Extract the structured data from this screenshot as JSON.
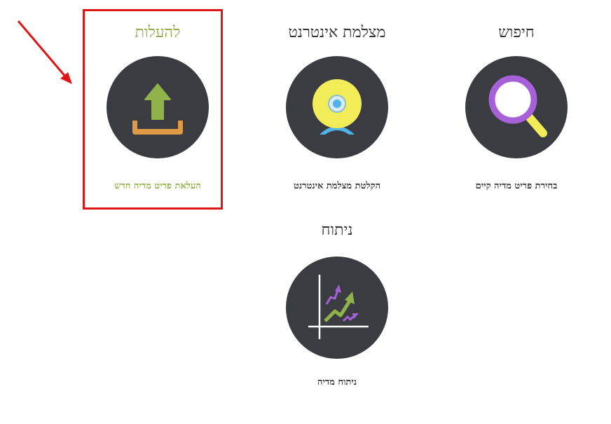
{
  "tiles": {
    "upload": {
      "title": "להעלות",
      "description": "העלאת פריט מדיה חדש",
      "icon": "upload-icon"
    },
    "webcam": {
      "title": "מצלמת אינטרנט",
      "description": "הקלטת מצלמת אינטרנט",
      "icon": "webcam-icon"
    },
    "search": {
      "title": "חיפוש",
      "description": "בחירת פריט מדיה קיים",
      "icon": "search-icon"
    },
    "analysis": {
      "title": "ניתוח",
      "description": "ניתוח מדיה",
      "icon": "analytics-chart-icon"
    }
  },
  "colors": {
    "circle": "#3a3c42",
    "active_text": "#8fae45",
    "highlight": "#e01515"
  }
}
